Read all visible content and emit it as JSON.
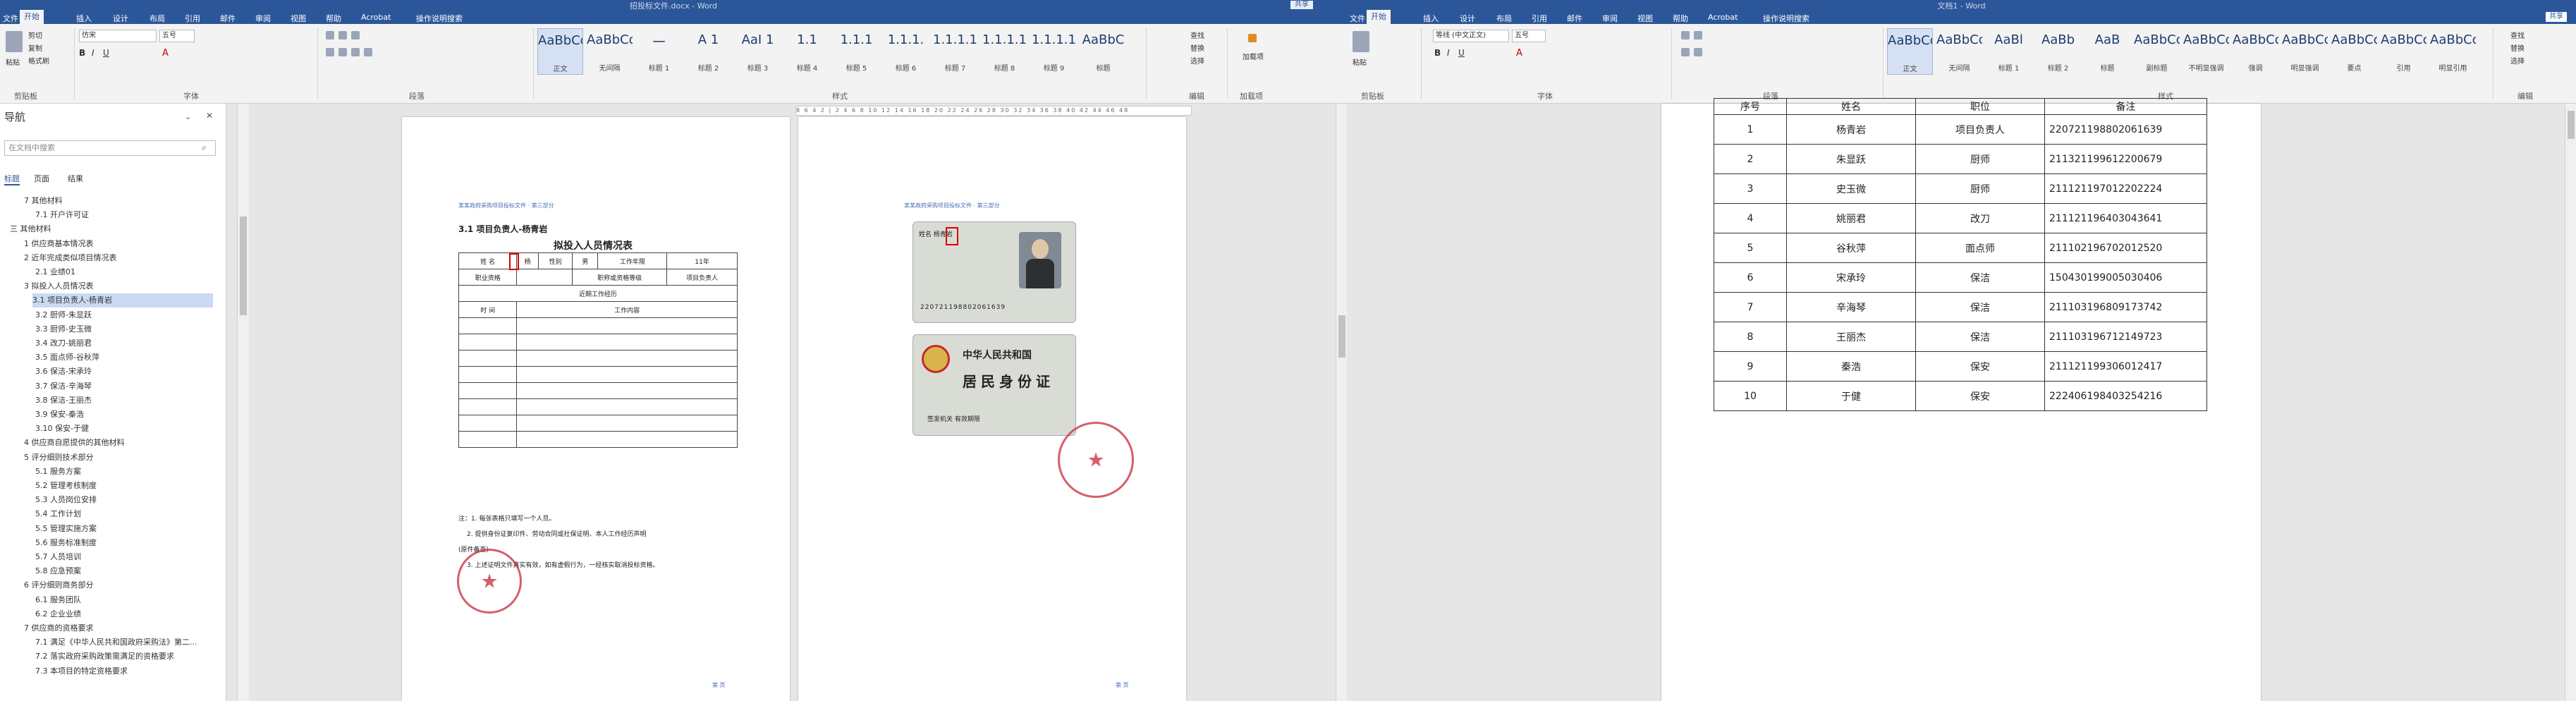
{
  "winA": {
    "title": "招投标文件.docx - Word",
    "share": "共享",
    "menu": [
      "文件",
      "开始",
      "插入",
      "设计",
      "布局",
      "引用",
      "邮件",
      "审阅",
      "视图",
      "帮助",
      "Acrobat",
      "操作说明搜索"
    ],
    "ribbon": {
      "clipboard_label": "剪贴板",
      "paste": "粘贴",
      "cut": "剪切",
      "copy": "复制",
      "format_painter": "格式刷",
      "font_label": "字体",
      "font_name": "仿宋",
      "font_size": "五号",
      "paragraph_label": "段落",
      "styles_label": "样式",
      "editing_label": "编辑",
      "find": "查找",
      "replace": "替换",
      "select": "选择",
      "addins_label": "加载项",
      "addins_btn": "加载项",
      "styles": [
        {
          "sample": "AaBbCcDd",
          "name": "正文"
        },
        {
          "sample": "AaBbCcDd",
          "name": "无间隔"
        },
        {
          "sample": "一",
          "name": "标题 1"
        },
        {
          "sample": "A 1",
          "name": "标题 2"
        },
        {
          "sample": "AaI 1",
          "name": "标题 3"
        },
        {
          "sample": "1.1",
          "name": "标题 4"
        },
        {
          "sample": "1.1.1",
          "name": "标题 5"
        },
        {
          "sample": "1.1.1.",
          "name": "标题 6"
        },
        {
          "sample": "1.1.1.1",
          "name": "标题 7"
        },
        {
          "sample": "1.1.1.1",
          "name": "标题 8"
        },
        {
          "sample": "1.1.1.1",
          "name": "标题 9"
        },
        {
          "sample": "AaBbC",
          "name": "标题"
        }
      ]
    },
    "nav": {
      "title": "导航",
      "search_placeholder": "在文档中搜索",
      "tabs": [
        "标题",
        "页面",
        "结果"
      ],
      "items": [
        "7 其他材料",
        "7.1 开户许可证",
        "三 其他材料",
        "1 供应商基本情况表",
        "2 近年完成类似项目情况表",
        "2.1 业绩01",
        "3 拟投入人员情况表",
        "3.1 项目负责人-杨青岩",
        "3.2 厨师-朱显跃",
        "3.3 厨师-史玉微",
        "3.4 改刀-姚丽君",
        "3.5 面点师-谷秋萍",
        "3.6 保洁-宋承玲",
        "3.7 保洁-辛海琴",
        "3.8 保洁-王丽杰",
        "3.9 保安-秦浩",
        "3.10 保安-于健",
        "4 供应商自愿提供的其他材料",
        "5 评分细则技术部分",
        "5.1 服务方案",
        "5.2 管理考核制度",
        "5.3 人员岗位安排",
        "5.4 工作计划",
        "5.5 管理实施方案",
        "5.6 服务标准制度",
        "5.7 人员培训",
        "5.8 应急预案",
        "6 评分细则商务部分",
        "6.1 服务团队",
        "6.2 企业业绩",
        "7 供应商的资格要求",
        "7.1 满足《中华人民共和国政府采购法》第二...",
        "7.2 落实政府采购政策需满足的资格要求",
        "7.3 本项目的特定资格要求"
      ]
    },
    "page1": {
      "header": "某某政府采购项目投标文件 · 第三部分",
      "heading": "3.1  项目负责人-杨青岩",
      "table_title": "拟投入人员情况表",
      "table": {
        "row1": [
          "姓 名",
          "杨",
          "性别",
          "男",
          "工作年限",
          "11年"
        ],
        "row2": [
          "职业资格",
          "",
          "",
          "职称或资格等级",
          "",
          "项目负责人"
        ],
        "section": "近期工作经历",
        "row3": [
          "时  间",
          "工作内容"
        ]
      },
      "notes": [
        "注：1. 每张表格只填写一个人员。",
        "2. 提供身份证复印件、劳动合同或社保证明、本人工作经历声明",
        "(原件备查)",
        "3. 上述证明文件真实有效，如有虚假行为，一经核实取消投标资格。"
      ],
      "footer": "第 页"
    },
    "page2": {
      "header": "某某政府采购项目投标文件 · 第三部分",
      "id_front_text": "姓名 杨青岩",
      "id_number": "220721198802061639",
      "id_back_title": "中华人民共和国",
      "id_back_subtitle": "居民身份证",
      "id_back_footer": "签发机关  有效期限",
      "footer": "第 页"
    }
  },
  "winB": {
    "title": "文档1 - Word",
    "share": "共享",
    "menu": [
      "文件",
      "开始",
      "插入",
      "设计",
      "布局",
      "引用",
      "邮件",
      "审阅",
      "视图",
      "帮助",
      "Acrobat",
      "操作说明搜索"
    ],
    "ribbon": {
      "clipboard_label": "剪贴板",
      "paste": "粘贴",
      "font_label": "字体",
      "font_name": "等线 (中文正文)",
      "font_size": "五号",
      "paragraph_label": "段落",
      "styles_label": "样式",
      "editing_label": "编辑",
      "find": "查找",
      "replace": "替换",
      "select": "选择",
      "styles": [
        {
          "sample": "AaBbCcDd",
          "name": "正文"
        },
        {
          "sample": "AaBbCcD",
          "name": "无间隔"
        },
        {
          "sample": "AaBl",
          "name": "标题 1"
        },
        {
          "sample": "AaBb",
          "name": "标题 2"
        },
        {
          "sample": "AaB",
          "name": "标题"
        },
        {
          "sample": "AaBbCc",
          "name": "副标题"
        },
        {
          "sample": "AaBbCcD",
          "name": "不明显强调"
        },
        {
          "sample": "AaBbCcD",
          "name": "强调"
        },
        {
          "sample": "AaBbCcD",
          "name": "明显强调"
        },
        {
          "sample": "AaBbCcD",
          "name": "要点"
        },
        {
          "sample": "AaBbCcD",
          "name": "引用"
        },
        {
          "sample": "AaBbCcD",
          "name": "明显引用"
        }
      ]
    },
    "table": {
      "header": [
        "序号",
        "姓名",
        "职位",
        "备注"
      ],
      "rows": [
        [
          "1",
          "杨青岩",
          "项目负责人",
          "220721198802061639"
        ],
        [
          "2",
          "朱显跃",
          "厨师",
          "211321199612200679"
        ],
        [
          "3",
          "史玉微",
          "厨师",
          "211121197012202224"
        ],
        [
          "4",
          "姚丽君",
          "改刀",
          "211121196403043641"
        ],
        [
          "5",
          "谷秋萍",
          "面点师",
          "211102196702012520"
        ],
        [
          "6",
          "宋承玲",
          "保洁",
          "150430199005030406"
        ],
        [
          "7",
          "辛海琴",
          "保洁",
          "211103196809173742"
        ],
        [
          "8",
          "王丽杰",
          "保洁",
          "211103196712149723"
        ],
        [
          "9",
          "秦浩",
          "保安",
          "211121199306012417"
        ],
        [
          "10",
          "于健",
          "保安",
          "222406198403254216"
        ]
      ]
    }
  }
}
